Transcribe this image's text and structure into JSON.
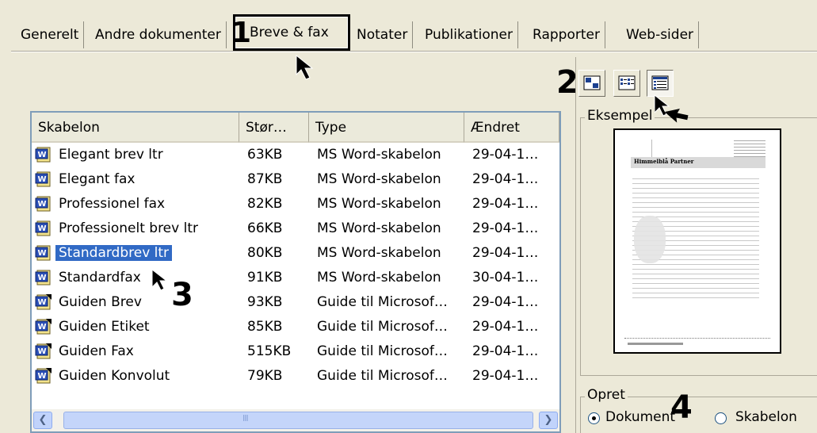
{
  "tabs": [
    {
      "label": "Generelt"
    },
    {
      "label": "Andre dokumenter"
    },
    {
      "label": "Breve & fax"
    },
    {
      "label": "Notater"
    },
    {
      "label": "Publikationer"
    },
    {
      "label": "Rapporter"
    },
    {
      "label": "Web-sider"
    }
  ],
  "annotations": {
    "n1": "1",
    "n2": "2",
    "n3": "3",
    "n4": "4"
  },
  "list": {
    "columns": [
      "Skabelon",
      "Stør…",
      "Type",
      "Ændret"
    ],
    "rows": [
      {
        "name": "Elegant brev ltr",
        "size": "63KB",
        "type": "MS Word-skabelon",
        "modified": "29-04-1…",
        "icon": "word-template-icon"
      },
      {
        "name": "Elegant fax",
        "size": "87KB",
        "type": "MS Word-skabelon",
        "modified": "29-04-1…",
        "icon": "word-template-icon"
      },
      {
        "name": "Professionel fax",
        "size": "82KB",
        "type": "MS Word-skabelon",
        "modified": "29-04-1…",
        "icon": "word-template-icon"
      },
      {
        "name": "Professionelt brev ltr",
        "size": "66KB",
        "type": "MS Word-skabelon",
        "modified": "29-04-1…",
        "icon": "word-template-icon"
      },
      {
        "name": "Standardbrev ltr",
        "size": "80KB",
        "type": "MS Word-skabelon",
        "modified": "29-04-1…",
        "icon": "word-template-icon",
        "selected": true
      },
      {
        "name": "Standardfax",
        "size": "91KB",
        "type": "MS Word-skabelon",
        "modified": "30-04-1…",
        "icon": "word-template-icon"
      },
      {
        "name": "Guiden Brev",
        "size": "93KB",
        "type": "Guide til Microsof…",
        "modified": "29-04-1…",
        "icon": "word-wizard-icon"
      },
      {
        "name": "Guiden Etiket",
        "size": "85KB",
        "type": "Guide til Microsof…",
        "modified": "29-04-1…",
        "icon": "word-wizard-icon"
      },
      {
        "name": "Guiden Fax",
        "size": "515KB",
        "type": "Guide til Microsof…",
        "modified": "29-04-1…",
        "icon": "word-wizard-icon"
      },
      {
        "name": "Guiden Konvolut",
        "size": "79KB",
        "type": "Guide til Microsof…",
        "modified": "29-04-1…",
        "icon": "word-wizard-icon"
      }
    ],
    "scroll_thumb_glyph": "III"
  },
  "preview": {
    "group_title": "Eksempel",
    "doc_heading": "Himmelblå Partner"
  },
  "create": {
    "group_title": "Opret",
    "options": [
      {
        "label": "Dokument",
        "selected": true
      },
      {
        "label": "Skabelon",
        "selected": false
      }
    ]
  },
  "colors": {
    "selection": "#316ac5",
    "dialog_bg": "#ece9d8",
    "list_border": "#7f9db9"
  }
}
